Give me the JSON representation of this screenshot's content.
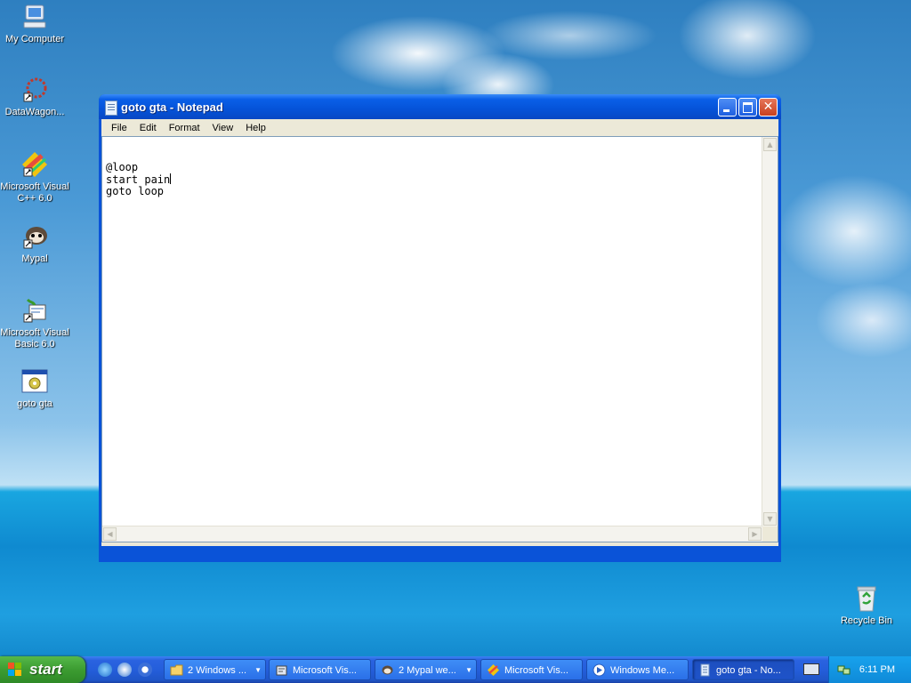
{
  "desktop": {
    "icons": [
      {
        "label": "My Computer"
      },
      {
        "label": "DataWagon..."
      },
      {
        "label_line1": "Microsoft Visual",
        "label_line2": "C++ 6.0"
      },
      {
        "label": "Mypal"
      },
      {
        "label_line1": "Microsoft Visual",
        "label_line2": "Basic 6.0"
      },
      {
        "label": "goto gta"
      },
      {
        "label": "Recycle Bin"
      }
    ]
  },
  "notepad": {
    "title": "goto gta - Notepad",
    "menu": [
      "File",
      "Edit",
      "Format",
      "View",
      "Help"
    ],
    "lines": [
      "@loop",
      "start pain",
      "goto loop"
    ]
  },
  "taskbar": {
    "start_label": "start",
    "tasks": [
      {
        "label": "2 Windows ..."
      },
      {
        "label": "Microsoft Vis..."
      },
      {
        "label": "2 Mypal we..."
      },
      {
        "label": "Microsoft Vis..."
      },
      {
        "label": "Windows Me..."
      },
      {
        "label": "goto gta - No..."
      }
    ],
    "clock": "6:11 PM"
  },
  "colors": {
    "title_bar": "#0553d8",
    "taskbar": "#245edb",
    "start_button": "#3c9c31",
    "tray": "#0f8ad8"
  }
}
